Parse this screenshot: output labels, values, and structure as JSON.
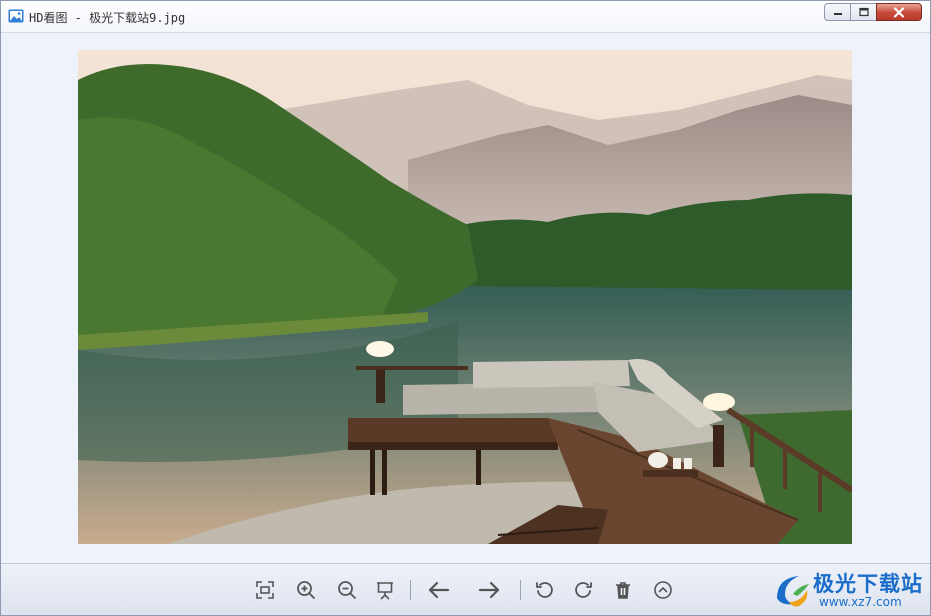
{
  "window": {
    "title": "HD看图 - 极光下载站9.jpg"
  },
  "image": {
    "description_icon": "landscape-photo"
  },
  "toolbar": {
    "buttons": [
      {
        "name": "fit-screen",
        "icon": "fit-screen-icon"
      },
      {
        "name": "zoom-in",
        "icon": "zoom-in-icon"
      },
      {
        "name": "zoom-out",
        "icon": "zoom-out-icon"
      },
      {
        "name": "slideshow",
        "icon": "slideshow-icon"
      },
      {
        "name": "previous",
        "icon": "arrow-left-icon"
      },
      {
        "name": "next",
        "icon": "arrow-right-icon"
      },
      {
        "name": "rotate-left",
        "icon": "rotate-left-icon"
      },
      {
        "name": "rotate-right",
        "icon": "rotate-right-icon"
      },
      {
        "name": "delete",
        "icon": "trash-icon"
      },
      {
        "name": "more",
        "icon": "chevron-up-circle-icon"
      }
    ]
  },
  "watermark": {
    "brand": "极光下载站",
    "url": "www.xz7.com"
  },
  "colors": {
    "accent": "#1a6dc9",
    "close": "#c7493a",
    "icon": "#555555"
  }
}
